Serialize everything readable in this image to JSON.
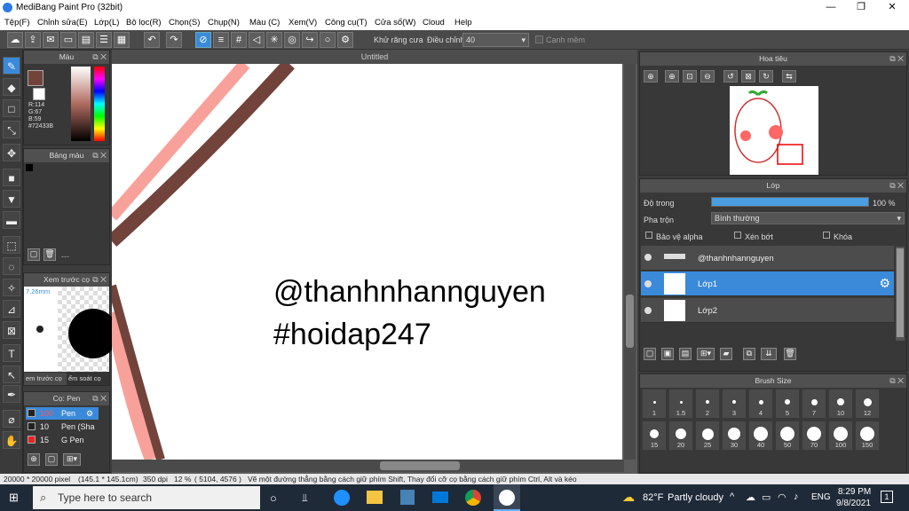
{
  "window": {
    "title": "MediBang Paint Pro (32bit)",
    "minimize": "—",
    "maximize": "❐",
    "close": "✕"
  },
  "menu": [
    "Tệp(F)",
    "Chỉnh sửa(E)",
    "Lớp(L)",
    "Bộ lọc(R)",
    "Chọn(S)",
    "Chụp(N)",
    "Màu (C)",
    "Xem(V)",
    "Công cụ(T)",
    "Cửa sổ(W)",
    "Cloud",
    "Help"
  ],
  "toolbar": {
    "antialias_label": "Khử răng cưa",
    "adjust_label": "Điều chỉnh",
    "adjust_value": "40",
    "edge_label": "Cạnh mềm"
  },
  "color_panel": {
    "title": "Màu",
    "r": "R:114",
    "g": "G:67",
    "b": "B:59",
    "hex": "#72433B",
    "primary": "#72433B"
  },
  "palette_panel": {
    "title": "Bảng màu",
    "ellipsis": "---"
  },
  "preview_panel": {
    "title": "Xem trước cọ",
    "size": "7.26mm",
    "tab1": "em trước cọ",
    "tab2": "ểm soát cọ"
  },
  "brush_panel": {
    "title": "Cọ: Pen",
    "items": [
      {
        "size": "100",
        "name": "Pen",
        "sel": true
      },
      {
        "size": "10",
        "name": "Pen (Sha",
        "sel": false
      },
      {
        "size": "15",
        "name": "G Pen",
        "sel": false
      }
    ]
  },
  "canvas": {
    "title": "Untitled",
    "line1": "@thanhnhannguyen",
    "line2": "#hoidap247"
  },
  "navigator": {
    "title": "Hoa tiêu"
  },
  "layer_panel": {
    "title": "Lớp",
    "opacity_label": "Độ trong",
    "opacity_value": "100 %",
    "opacity": 1.0,
    "blend_label": "Pha trộn",
    "blend_value": "Bình thường",
    "protect_alpha": "Bảo vệ alpha",
    "clipping": "Xén bớt",
    "lock": "Khóa",
    "layers": [
      {
        "name": "@thanhnhannguyen",
        "sel": false
      },
      {
        "name": "Lớp1",
        "sel": true
      },
      {
        "name": "Lớp2",
        "sel": false
      }
    ]
  },
  "brush_size": {
    "title": "Brush Size",
    "row1": [
      "1",
      "1.5",
      "2",
      "3",
      "4",
      "5",
      "7",
      "10",
      "12"
    ],
    "row2": [
      "15",
      "20",
      "25",
      "30",
      "40",
      "50",
      "70",
      "100",
      "150"
    ]
  },
  "status": {
    "size": "20000 * 20000 pixel",
    "cm": "(145.1 * 145.1cm)",
    "dpi": "350 dpi",
    "zoom": "12 %",
    "coords": "( 5104, 4576 )",
    "hint": "Vẽ một đường thẳng bằng cách giữ phím Shift, Thay đổi cỡ cọ bằng cách giữ phím Ctrl, Alt và kéo"
  },
  "taskbar": {
    "search_placeholder": "Type here to search",
    "weather_temp": "82°F",
    "weather_text": "Partly cloudy",
    "lang": "ENG",
    "time": "8:29 PM",
    "date": "9/8/2021",
    "notif": "1"
  }
}
